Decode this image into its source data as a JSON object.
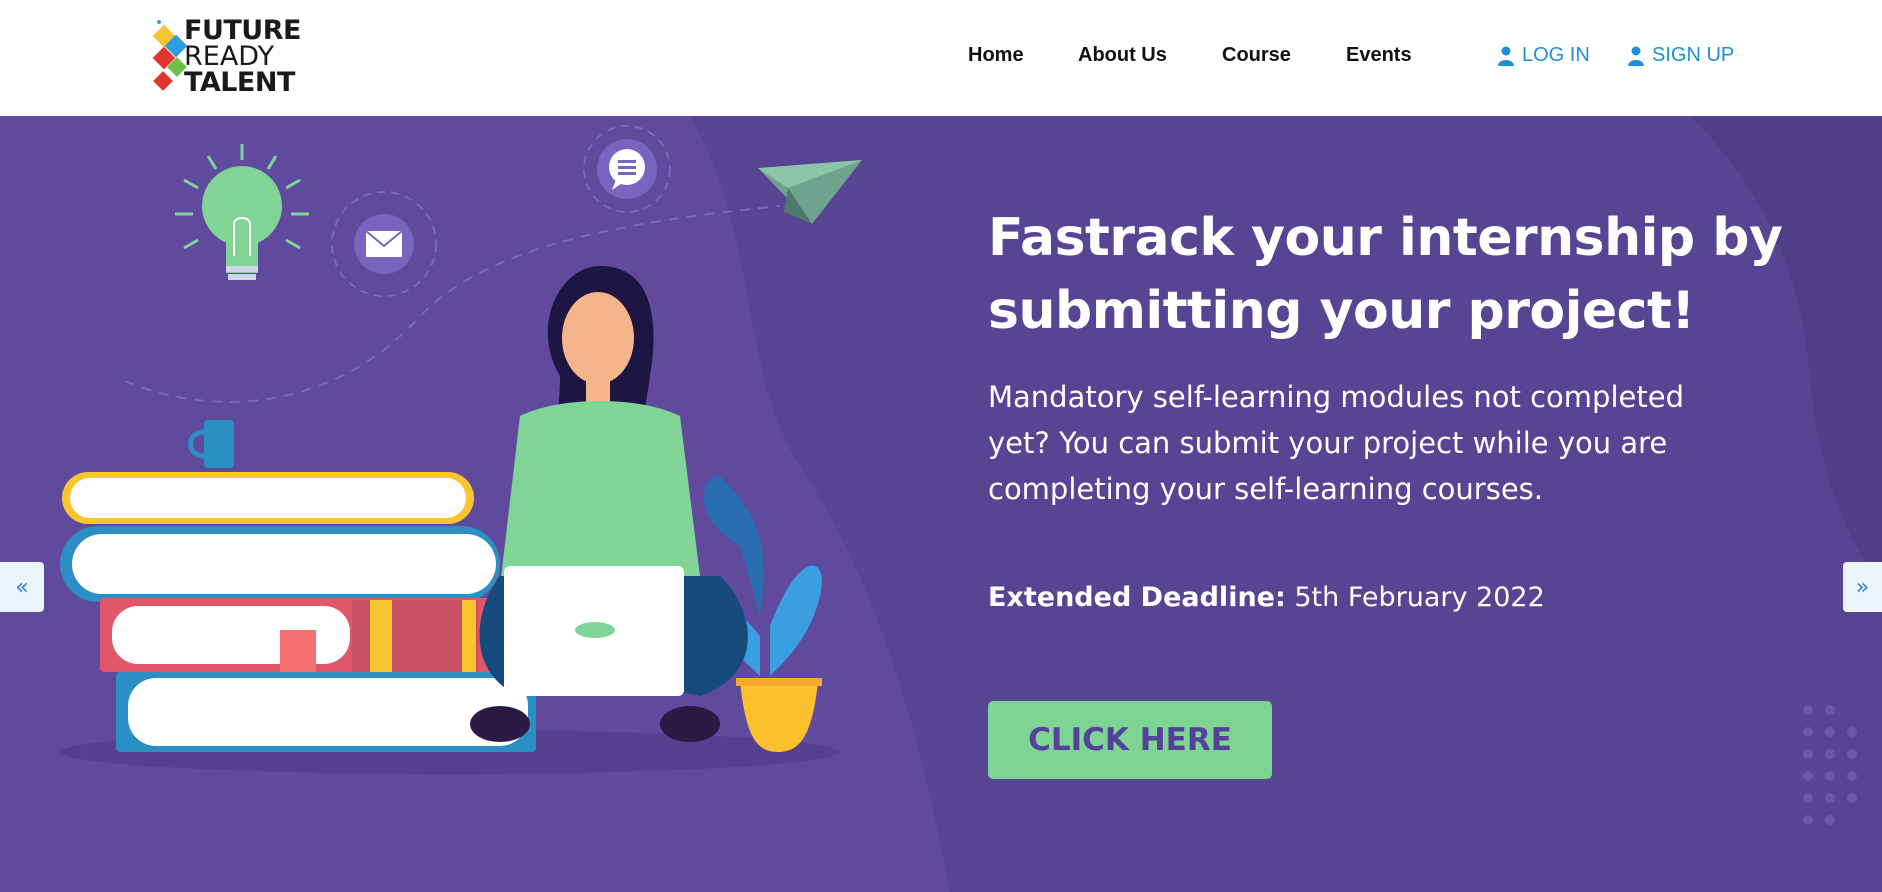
{
  "header": {
    "logo": {
      "line1": "FUTURE",
      "line2": "READY",
      "line3": "TALENT"
    },
    "nav": [
      {
        "label": "Home"
      },
      {
        "label": "About Us"
      },
      {
        "label": "Course"
      },
      {
        "label": "Events"
      }
    ],
    "login_label": "LOG IN",
    "signup_label": "SIGN UP"
  },
  "hero": {
    "headline_line1": "Fastrack your internship by",
    "headline_line2": "submitting your project!",
    "subtext_line1": "Mandatory self-learning modules not completed",
    "subtext_line2": "yet? You can submit your project while you are",
    "subtext_line3": "completing your self-learning courses.",
    "deadline_label": "Extended Deadline:",
    "deadline_value": "5th February 2022",
    "cta_label": "CLICK HERE",
    "prev_arrow": "«",
    "next_arrow": "»"
  },
  "colors": {
    "hero_bg": "#5b4a9b",
    "accent_green": "#7ed493",
    "link_blue": "#1e8fd6"
  }
}
